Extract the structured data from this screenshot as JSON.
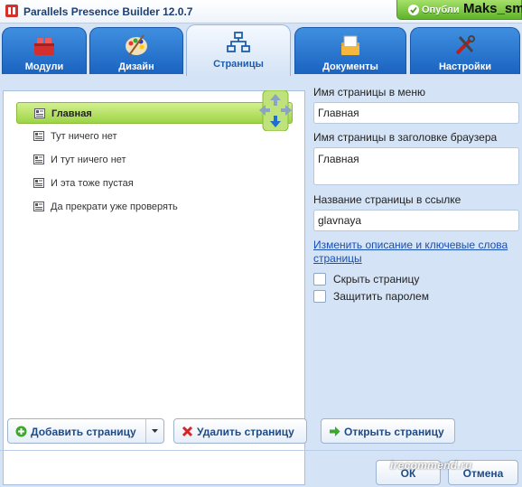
{
  "app": {
    "title": "Parallels Presence Builder 12.0.7",
    "publish_label": "Опубли",
    "username": "Maks_sm"
  },
  "tabs": [
    {
      "label": "Модули",
      "icon": "modules-icon",
      "active": false
    },
    {
      "label": "Дизайн",
      "icon": "design-palette-icon",
      "active": false
    },
    {
      "label": "Страницы",
      "icon": "pages-sitemap-icon",
      "active": true
    },
    {
      "label": "Документы",
      "icon": "documents-icon",
      "active": false
    },
    {
      "label": "Настройки",
      "icon": "settings-tools-icon",
      "active": false
    }
  ],
  "pages": [
    {
      "label": "Главная",
      "selected": true
    },
    {
      "label": "Тут ничего нет",
      "selected": false
    },
    {
      "label": "И тут ничего нет",
      "selected": false
    },
    {
      "label": "И эта тоже пустая",
      "selected": false
    },
    {
      "label": "Да прекрати уже проверять",
      "selected": false
    }
  ],
  "form": {
    "menu_name_label": "Имя страницы в меню",
    "menu_name_value": "Главная",
    "browser_title_label": "Имя страницы в заголовке браузера",
    "browser_title_value": "Главная",
    "link_name_label": "Название страницы в ссылке",
    "link_name_value": "glavnaya",
    "meta_link": "Изменить описание и ключевые слова страницы",
    "hide_page_label": "Скрыть страницу",
    "hide_page_checked": false,
    "password_label": "Защитить паролем",
    "password_checked": false
  },
  "buttons": {
    "add": "Добавить страницу",
    "delete": "Удалить страницу",
    "open": "Открыть страницу",
    "ok": "ОК",
    "cancel": "Отмена"
  },
  "watermark": "irecommend.ru",
  "colors": {
    "accent_blue": "#1a63c0",
    "selected_green": "#9ed445",
    "publish_green": "#5fb32a"
  }
}
